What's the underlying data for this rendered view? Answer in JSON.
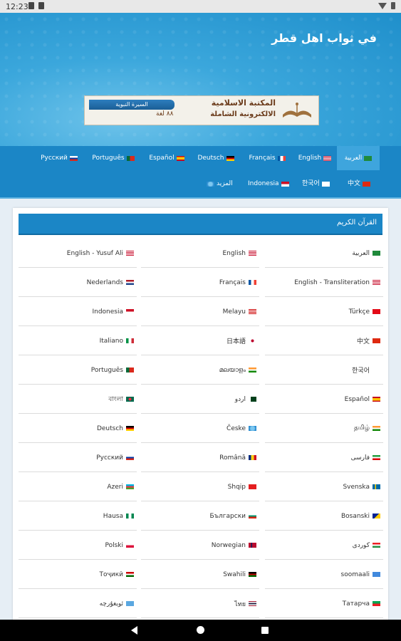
{
  "status_bar": {
    "time": "12:23"
  },
  "header": {
    "site_title": "في ثواب اهل قطر",
    "banner": {
      "line1": "المكتبة الاسلامية",
      "line2": "الالكترونية الشاملة",
      "lang_count": "٨٨ لغة",
      "tag": "السيرة النبوية"
    }
  },
  "nav": {
    "row1": [
      {
        "label": "العربية",
        "flag": "sa",
        "active": true
      },
      {
        "label": "English",
        "flag": "us"
      },
      {
        "label": "Français",
        "flag": "fr"
      },
      {
        "label": "Deutsch",
        "flag": "de"
      },
      {
        "label": "Español",
        "flag": "es"
      },
      {
        "label": "Português",
        "flag": "pt"
      },
      {
        "label": "Русский",
        "flag": "ru"
      }
    ],
    "row2": [
      {
        "label": "中文",
        "flag": "cn"
      },
      {
        "label": "한국어",
        "flag": "kr"
      },
      {
        "label": "Indonesia",
        "flag": "id"
      },
      {
        "label": "المزيد",
        "flag": "globe"
      }
    ]
  },
  "card": {
    "title": "القرآن الكريم",
    "rows": [
      [
        {
          "label": "العربية",
          "flag": "sa"
        },
        {
          "label": "English",
          "flag": "us"
        },
        {
          "label": "English - Yusuf Ali",
          "flag": "us"
        }
      ],
      [
        {
          "label": "English - Transliteration",
          "flag": "us"
        },
        {
          "label": "Français",
          "flag": "fr"
        },
        {
          "label": "Nederlands",
          "flag": "nl"
        }
      ],
      [
        {
          "label": "Türkçe",
          "flag": "tr"
        },
        {
          "label": "Melayu",
          "flag": "my"
        },
        {
          "label": "Indonesia",
          "flag": "id"
        }
      ],
      [
        {
          "label": "中文",
          "flag": "cn"
        },
        {
          "label": "日本語",
          "flag": "jp"
        },
        {
          "label": "Italiano",
          "flag": "it"
        }
      ],
      [
        {
          "label": "한국어",
          "flag": "kr"
        },
        {
          "label": "മലയാളം",
          "flag": "in"
        },
        {
          "label": "Português",
          "flag": "pt"
        }
      ],
      [
        {
          "label": "Español",
          "flag": "es"
        },
        {
          "label": "اردو",
          "flag": "pk"
        },
        {
          "label": "বাংলা",
          "flag": "bd"
        }
      ],
      [
        {
          "label": "தமிழ்",
          "flag": "in"
        },
        {
          "label": "Česke",
          "flag": "globe"
        },
        {
          "label": "Deutsch",
          "flag": "de"
        }
      ],
      [
        {
          "label": "فارسی",
          "flag": "ir"
        },
        {
          "label": "Română",
          "flag": "ro"
        },
        {
          "label": "Русский",
          "flag": "ru"
        }
      ],
      [
        {
          "label": "Svenska",
          "flag": "se"
        },
        {
          "label": "Shqip",
          "flag": "al"
        },
        {
          "label": "Azeri",
          "flag": "az"
        }
      ],
      [
        {
          "label": "Bosanski",
          "flag": "ba"
        },
        {
          "label": "Български",
          "flag": "bg"
        },
        {
          "label": "Hausa",
          "flag": "ng"
        }
      ],
      [
        {
          "label": "کوردی",
          "flag": "ku"
        },
        {
          "label": "Norwegian",
          "flag": "no"
        },
        {
          "label": "Polski",
          "flag": "pl"
        }
      ],
      [
        {
          "label": "soomaali",
          "flag": "so"
        },
        {
          "label": "Swahili",
          "flag": "ke"
        },
        {
          "label": "Тоҷикӣ",
          "flag": "tj"
        }
      ],
      [
        {
          "label": "Татарча",
          "flag": "tt"
        },
        {
          "label": "ไทย",
          "flag": "th"
        },
        {
          "label": "ئويغۇرچە",
          "flag": "ug"
        }
      ]
    ]
  }
}
